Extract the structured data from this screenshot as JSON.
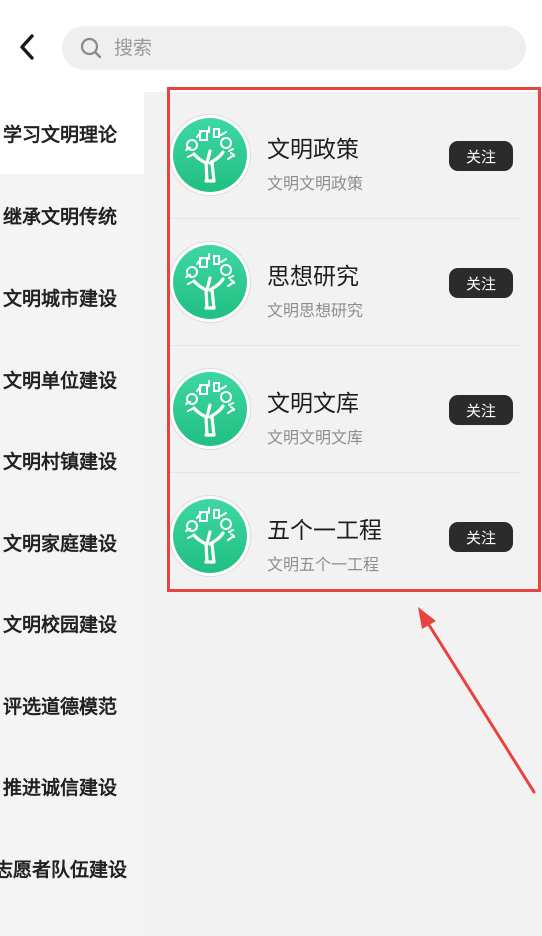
{
  "search": {
    "placeholder": "搜索"
  },
  "sidebar": {
    "items": [
      {
        "label": "学习文明理论",
        "active": true
      },
      {
        "label": "继承文明传统"
      },
      {
        "label": "文明城市建设"
      },
      {
        "label": "文明单位建设"
      },
      {
        "label": "文明村镇建设"
      },
      {
        "label": "文明家庭建设"
      },
      {
        "label": "文明校园建设"
      },
      {
        "label": "评选道德模范"
      },
      {
        "label": "推进诚信建设"
      },
      {
        "label": "志愿者队伍建设"
      }
    ]
  },
  "list": {
    "items": [
      {
        "title": "文明政策",
        "subtitle": "文明文明政策",
        "follow": "关注"
      },
      {
        "title": "思想研究",
        "subtitle": "文明思想研究",
        "follow": "关注"
      },
      {
        "title": "文明文库",
        "subtitle": "文明文明文库",
        "follow": "关注"
      },
      {
        "title": "五个一工程",
        "subtitle": "文明五个一工程",
        "follow": "关注"
      }
    ]
  },
  "colors": {
    "accent_red": "#e8433f",
    "avatar_gradient_top": "#3ed7a3",
    "avatar_gradient_bottom": "#21bf82",
    "follow_button": "#2b2b2b"
  },
  "icons": {
    "back": "chevron-left-icon",
    "search": "search-icon",
    "avatar": "tree-logo-icon"
  }
}
